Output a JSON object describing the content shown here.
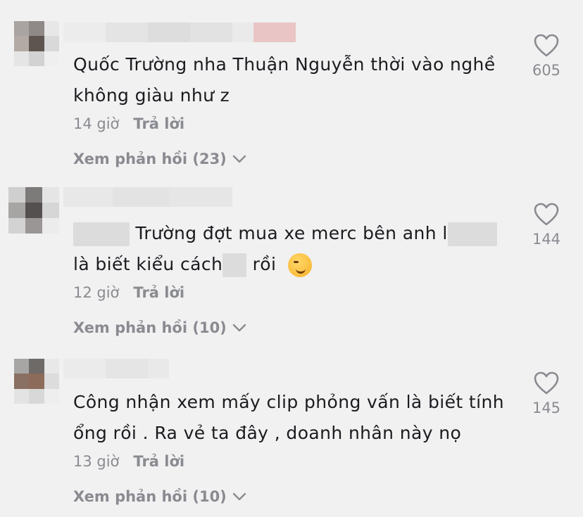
{
  "comments": [
    {
      "text_lines": [
        "Quốc Trường nha Thuận Nguyễn thời vào nghề",
        "không giàu như z"
      ],
      "time": "14 giờ",
      "reply_label": "Trả lời",
      "view_replies": "Xem phản hồi (23)",
      "likes": "605"
    },
    {
      "line1": "Trường đợt mua xe merc bên anh",
      "line1_tail": "l",
      "line2_a": "là biết kiểu cách",
      "line2_b": "rồi",
      "time": "12 giờ",
      "reply_label": "Trả lời",
      "view_replies": "Xem phản hồi (10)",
      "likes": "144"
    },
    {
      "text_lines": [
        "Công nhận xem mấy clip phỏng vấn là biết tính",
        "ổng rồi . Ra vẻ ta đây , doanh nhân này nọ"
      ],
      "time": "13 giờ",
      "reply_label": "Trả lời",
      "view_replies": "Xem phản hồi (10)",
      "likes": "145"
    }
  ],
  "colors": {
    "background": "#f1f1f1",
    "text": "#1b1b20",
    "muted": "#8a8b91",
    "heart_outline": "#8a8b91"
  },
  "icons": {
    "like": "heart-outline-icon",
    "expand": "chevron-down-icon",
    "emoji": "smirking-face-emoji"
  }
}
